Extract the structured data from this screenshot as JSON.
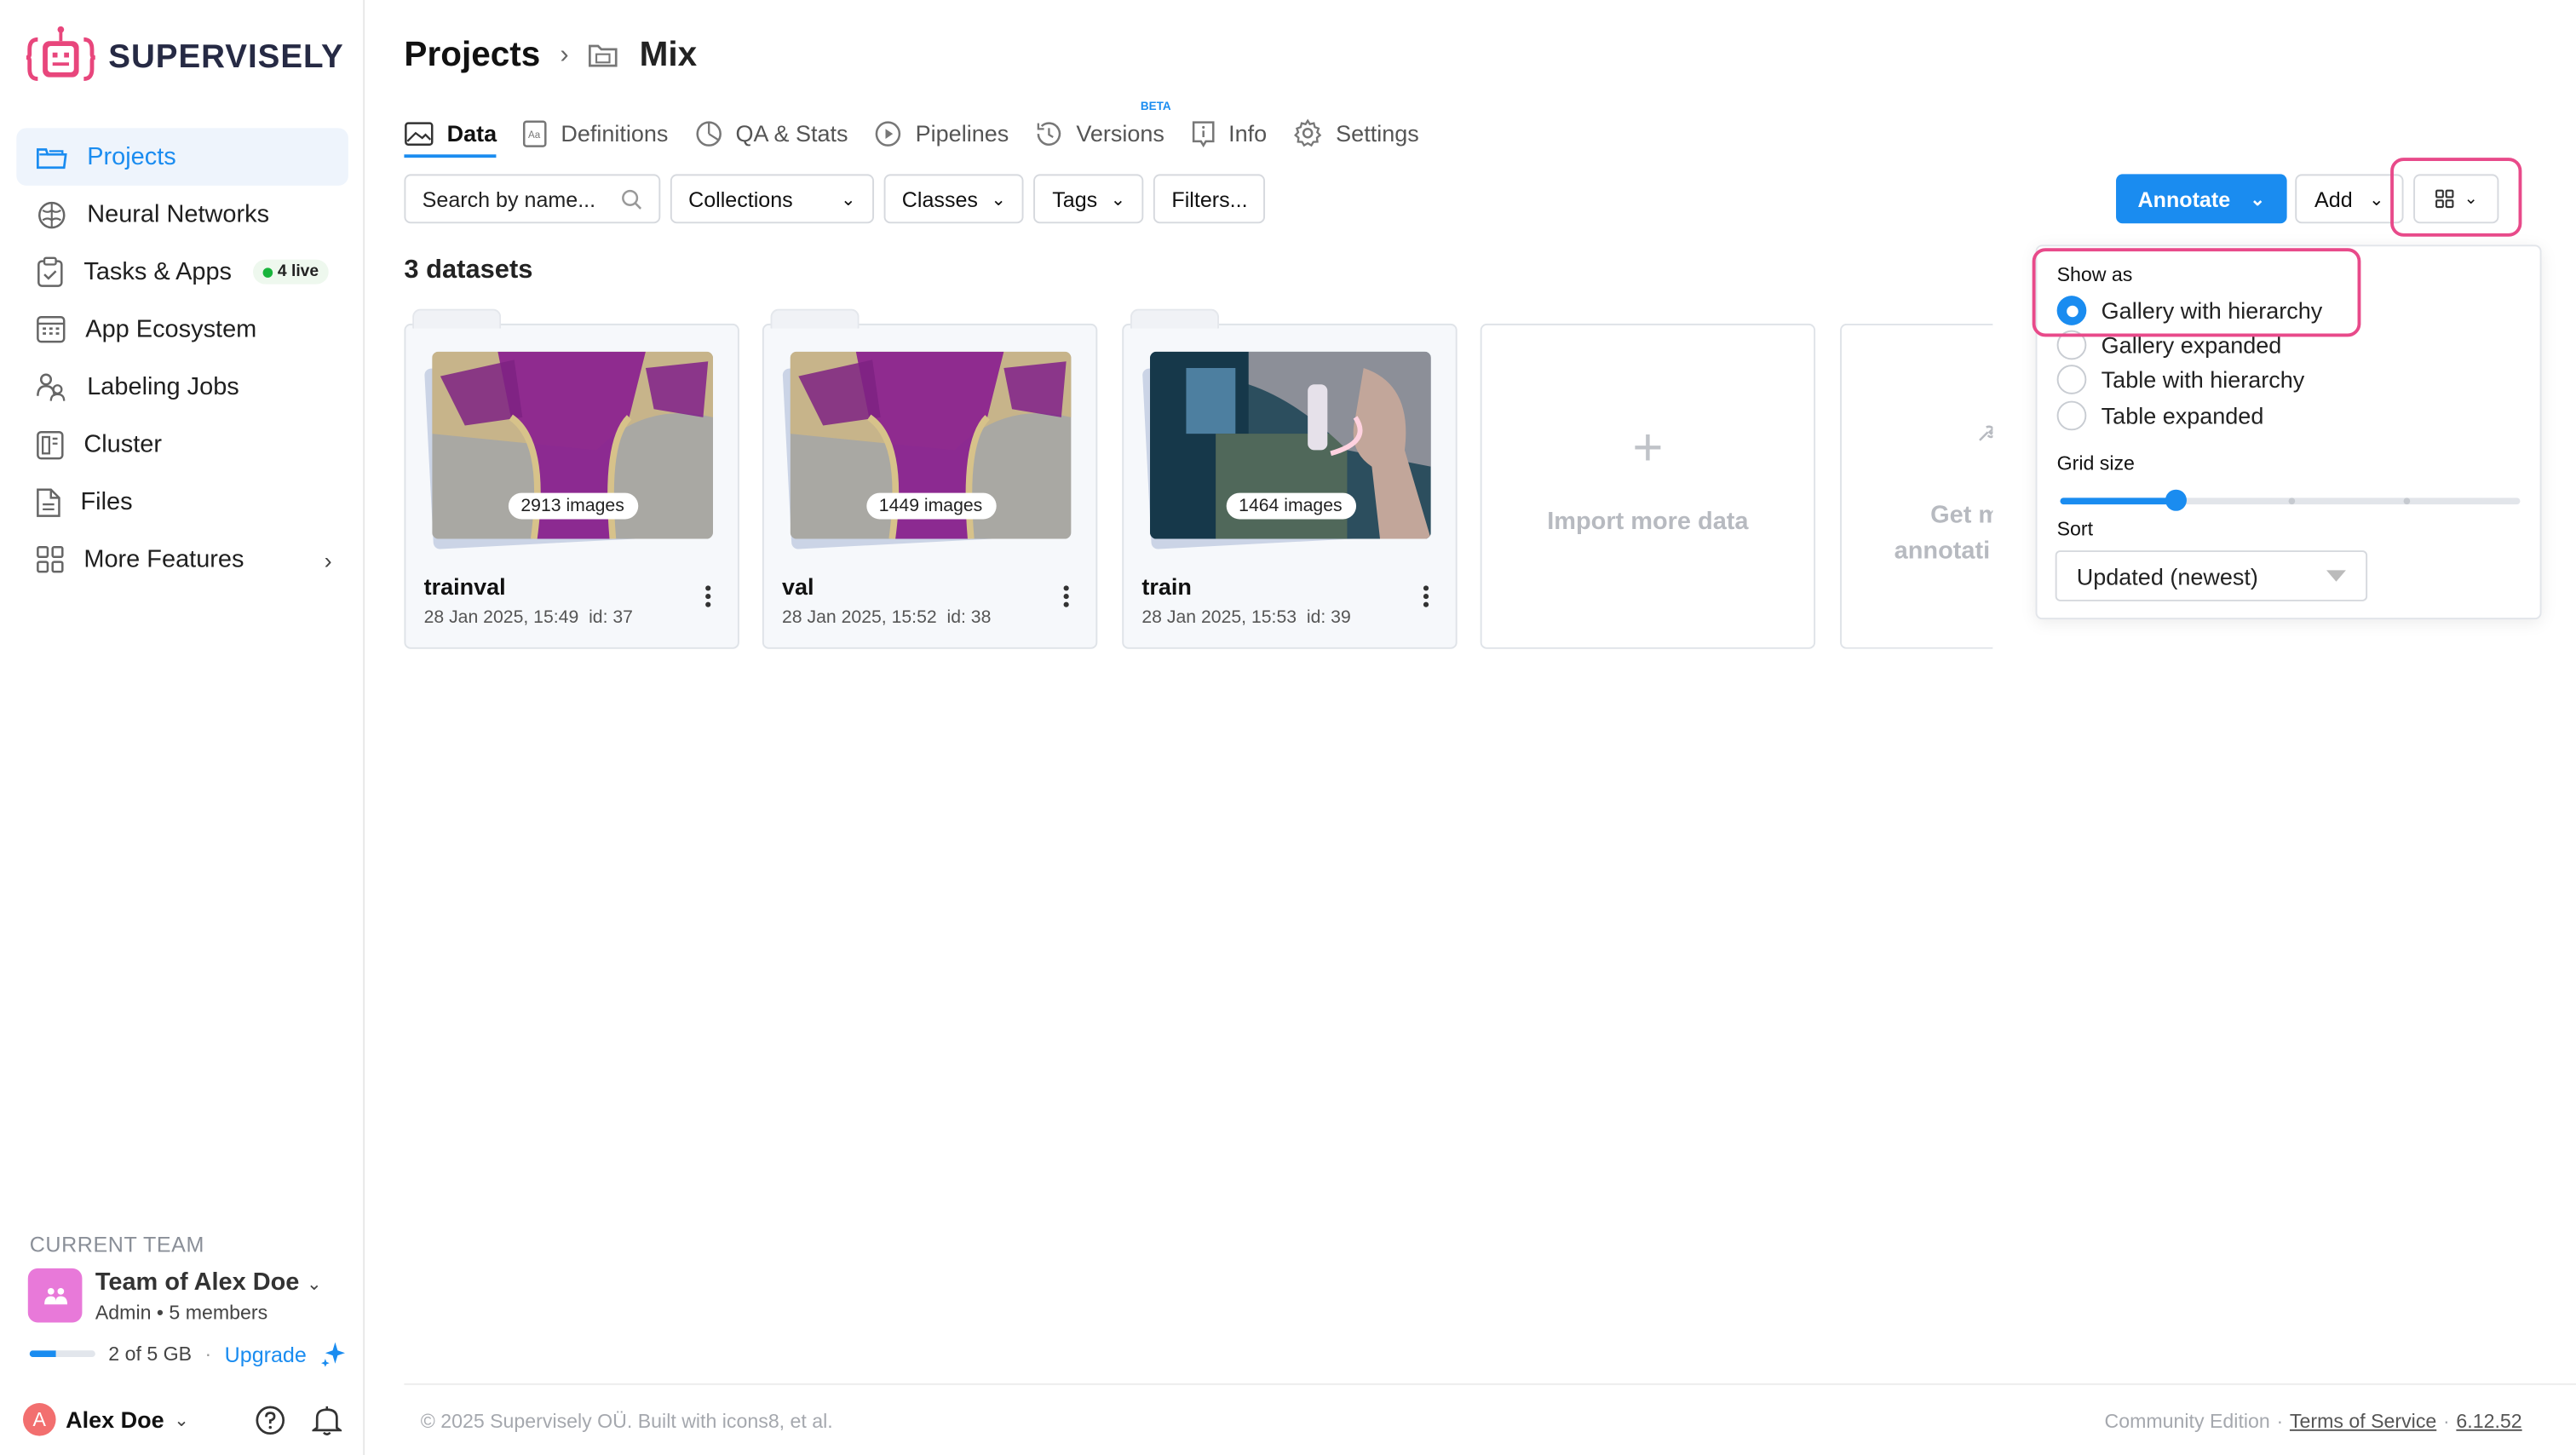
{
  "app": {
    "brand": "SUPERVISELY",
    "brand_color": "#e8467c",
    "accent": "#1a8cf0"
  },
  "sidebar": {
    "items": [
      {
        "label": "Projects",
        "icon": "folder-icon",
        "active": true
      },
      {
        "label": "Neural Networks",
        "icon": "brain-icon"
      },
      {
        "label": "Tasks & Apps",
        "icon": "clipboard-check-icon",
        "badge": "4 live"
      },
      {
        "label": "App Ecosystem",
        "icon": "app-grid-icon"
      },
      {
        "label": "Labeling Jobs",
        "icon": "people-icon"
      },
      {
        "label": "Cluster",
        "icon": "server-icon"
      },
      {
        "label": "Files",
        "icon": "file-icon"
      },
      {
        "label": "More Features",
        "icon": "grid-icon"
      }
    ],
    "team_label": "CURRENT TEAM",
    "team_name": "Team of Alex Doe",
    "team_role": "Admin",
    "team_members": "5 members",
    "storage_text": "2 of 5 GB",
    "storage_fraction": 0.4,
    "upgrade_label": "Upgrade",
    "user_initial": "A",
    "user_name": "Alex Doe"
  },
  "header": {
    "title": "Projects",
    "project": "Mix"
  },
  "tabs": [
    {
      "label": "Data",
      "icon": "image-icon",
      "active": true
    },
    {
      "label": "Definitions",
      "icon": "definitions-icon"
    },
    {
      "label": "QA & Stats",
      "icon": "pie-chart-icon"
    },
    {
      "label": "Pipelines",
      "icon": "play-circle-icon"
    },
    {
      "label": "Versions",
      "icon": "history-icon",
      "badge": "BETA"
    },
    {
      "label": "Info",
      "icon": "info-icon"
    },
    {
      "label": "Settings",
      "icon": "gear-icon"
    }
  ],
  "toolbar": {
    "search_placeholder": "Search by name...",
    "collections": "Collections",
    "classes": "Classes",
    "tags": "Tags",
    "filters": "Filters...",
    "annotate": "Annotate",
    "add": "Add"
  },
  "datasets": {
    "count_label": "3 datasets",
    "items": [
      {
        "name": "trainval",
        "images": "2913 images",
        "date": "28 Jan 2025, 15:49",
        "id": "id: 37"
      },
      {
        "name": "val",
        "images": "1449 images",
        "date": "28 Jan 2025, 15:52",
        "id": "id: 38"
      },
      {
        "name": "train",
        "images": "1464 images",
        "date": "28 Jan 2025, 15:53",
        "id": "id: 39"
      }
    ],
    "import_label": "Import more data",
    "partial_label_1": "Get m",
    "partial_label_2": "annotati"
  },
  "view_dropdown": {
    "show_as_label": "Show as",
    "options": [
      "Gallery with hierarchy",
      "Gallery expanded",
      "Table with hierarchy",
      "Table expanded"
    ],
    "selected_index": 0,
    "grid_size_label": "Grid size",
    "grid_size_level": 0.25,
    "sort_label": "Sort",
    "sort_value": "Updated (newest)"
  },
  "footer": {
    "copyright": "© 2025 Supervisely OÜ. Built with icons8, et al.",
    "edition": "Community Edition",
    "sep": "·",
    "terms": "Terms of Service",
    "version": "6.12.52"
  }
}
